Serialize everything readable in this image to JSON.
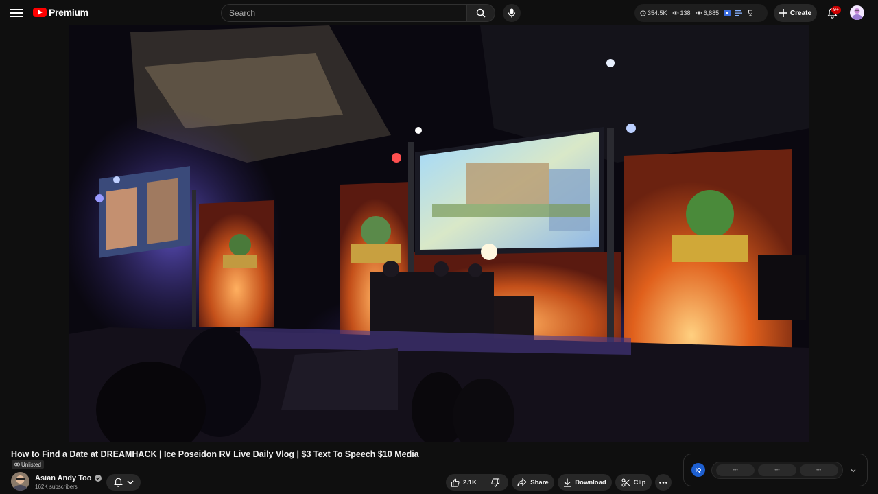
{
  "header": {
    "logo_text": "Premium",
    "search_placeholder": "Search",
    "stats": [
      {
        "icon": "clock-icon",
        "value": "354.5K"
      },
      {
        "icon": "eye-icon",
        "value": "138"
      },
      {
        "icon": "eye-icon",
        "value": "6,885"
      }
    ],
    "create_label": "Create",
    "notification_count": "9+"
  },
  "video": {
    "title": "How to Find a Date at DREAMHACK | Ice Poseidon RV Live Daily Vlog | $3 Text To Speech $10 Media",
    "visibility": "Unlisted",
    "channel_name": "Asian Andy Too",
    "subscribers": "162K subscribers",
    "likes": "2.1K"
  },
  "actions": {
    "share": "Share",
    "download": "Download",
    "clip": "Clip"
  },
  "extension": {
    "logo": "IQ",
    "pills": [
      "•••",
      "•••",
      "•••"
    ]
  },
  "colors": {
    "brand": "#ff0000",
    "background": "#0f0f0f",
    "button": "#272727",
    "badge": "#cc0000"
  }
}
